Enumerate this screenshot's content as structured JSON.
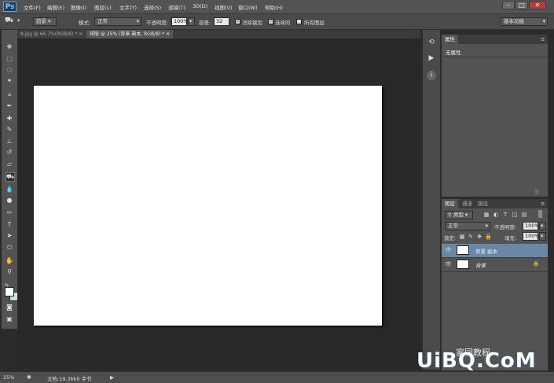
{
  "app": {
    "logo": "Ps"
  },
  "menu": [
    "文件(F)",
    "编辑(E)",
    "图像(I)",
    "图层(L)",
    "文字(Y)",
    "选择(S)",
    "滤镜(T)",
    "3D(D)",
    "视图(V)",
    "窗口(W)",
    "帮助(H)"
  ],
  "options": {
    "preset": "前景",
    "mode_label": "模式:",
    "mode_value": "正常",
    "opacity_label": "不透明度:",
    "opacity_value": "100%",
    "tolerance_label": "容差:",
    "tolerance_value": "32",
    "antialias": "消除锯齿",
    "contiguous": "连续的",
    "all_layers": "所有图层",
    "workspace": "基本功能"
  },
  "tabs": [
    "8.jpg @ 66.7%(RGB/8) *",
    "排版 @ 25% (背景 副本, RGB/8) *"
  ],
  "status": {
    "zoom": "25%",
    "doc": "文档:19.3M/0 字节"
  },
  "properties": {
    "tab": "属性",
    "content": "无属性"
  },
  "layers": {
    "tabs": [
      "图层",
      "通道",
      "路径"
    ],
    "filter": "类型",
    "blend": "正常",
    "opacity_label": "不透明度:",
    "opacity_value": "100%",
    "lock_label": "锁定:",
    "fill_label": "填充:",
    "fill_value": "100%",
    "items": [
      {
        "name": "背景 副本",
        "selected": true
      },
      {
        "name": "背景",
        "selected": false
      }
    ]
  },
  "watermark": {
    "text": "UiBQ.CoM",
    "cn": "家园教程"
  },
  "colors": {
    "foreground": "#ffffff",
    "background": "#c8e0e0",
    "accent": "#6a88a6"
  }
}
